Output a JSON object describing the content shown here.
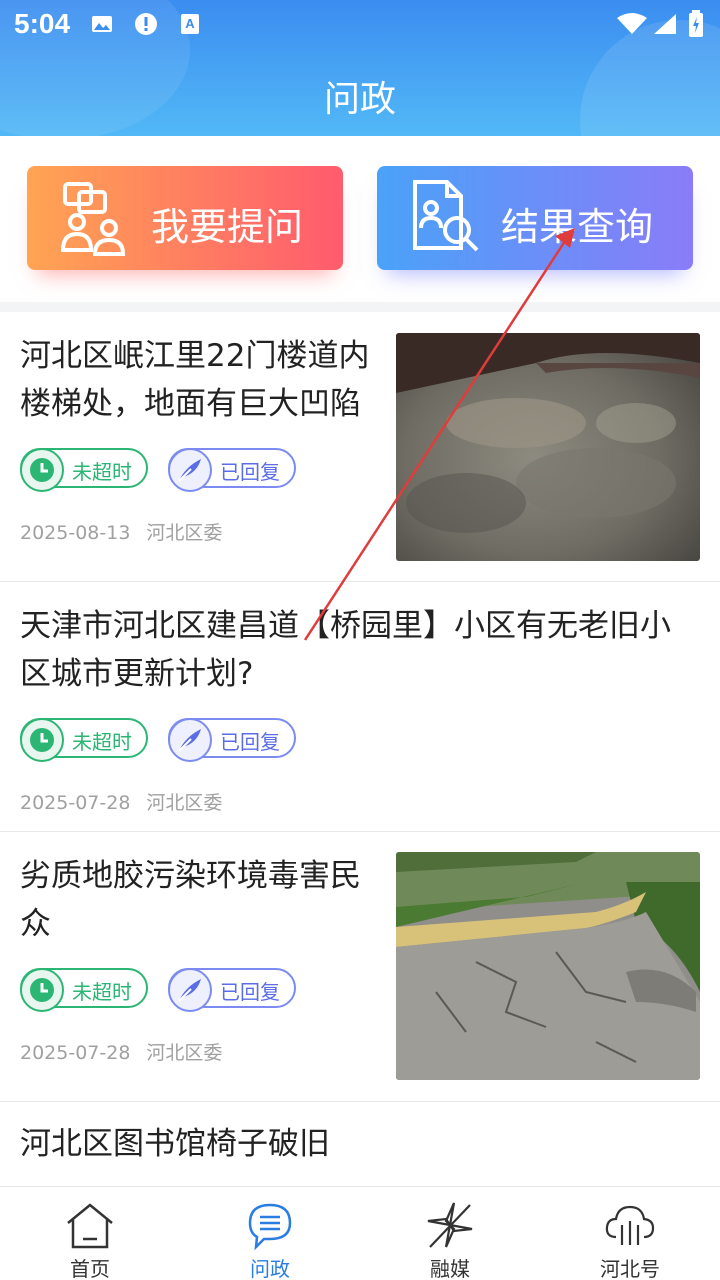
{
  "status_bar": {
    "time": "5:04"
  },
  "header": {
    "title": "问政"
  },
  "actions": {
    "ask_label": "我要提问",
    "query_label": "结果查询"
  },
  "news": [
    {
      "title_line1": "河北区岷江里22门楼道内",
      "title_line2": "楼梯处，地面有巨大凹陷",
      "tag_time": "未超时",
      "tag_reply": "已回复",
      "date": "2025-08-13",
      "org": "河北区委",
      "has_image": true
    },
    {
      "title_line1": "天津市河北区建昌道【桥园里】小区有无老旧小",
      "title_line2": "区城市更新计划?",
      "tag_time": "未超时",
      "tag_reply": "已回复",
      "date": "2025-07-28",
      "org": "河北区委",
      "has_image": false
    },
    {
      "title_line1": "劣质地胶污染环境毒害民",
      "title_line2": "众",
      "tag_time": "未超时",
      "tag_reply": "已回复",
      "date": "2025-07-28",
      "org": "河北区委",
      "has_image": true
    },
    {
      "title_line1": "河北区图书馆椅子破旧"
    }
  ],
  "bottom_nav": {
    "items": [
      {
        "label": "首页",
        "icon": "home-icon"
      },
      {
        "label": "问政",
        "icon": "message-icon",
        "active": true
      },
      {
        "label": "融媒",
        "icon": "pinwheel-icon"
      },
      {
        "label": "河北号",
        "icon": "cloud-icon"
      }
    ]
  },
  "colors": {
    "header_gradient_start": "#3b8df0",
    "header_gradient_end": "#52b8f6",
    "ask_gradient_start": "#ffa453",
    "ask_gradient_end": "#ff5b6e",
    "query_gradient_start": "#4aa2f8",
    "query_gradient_end": "#8a7cf8",
    "time_tag": "#2bb673",
    "reply_tag": "#7b8bf2",
    "nav_active": "#2a7de1",
    "annotation_arrow": "#e03c3c"
  }
}
